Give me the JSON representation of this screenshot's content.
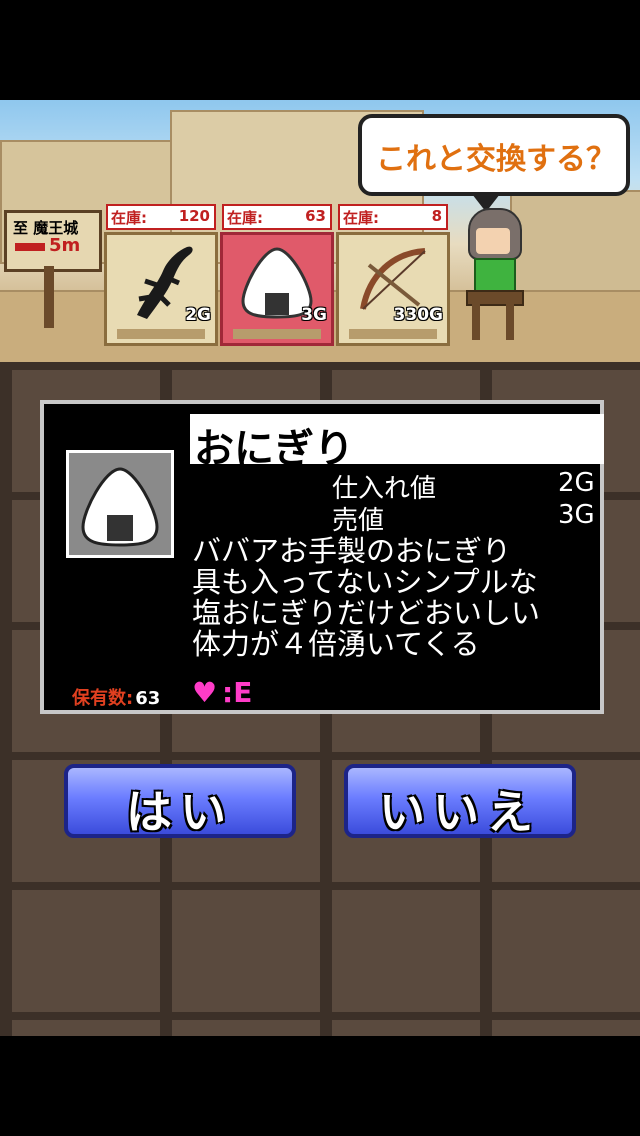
{
  "scene": {
    "signpost": {
      "line1": "至 魔王城",
      "line2": "5m"
    },
    "speech_bubble": "これと交換する？",
    "shop_slots": [
      {
        "stock_label": "在庫:",
        "stock_value": "120",
        "price": "2G",
        "item_icon": "lizard-icon",
        "selected": false
      },
      {
        "stock_label": "在庫:",
        "stock_value": "63",
        "price": "3G",
        "item_icon": "onigiri-icon",
        "selected": true
      },
      {
        "stock_label": "在庫:",
        "stock_value": "8",
        "price": "330G",
        "item_icon": "bow-icon",
        "selected": false
      }
    ]
  },
  "item_panel": {
    "name": "おにぎり",
    "purchase_price_label": "仕入れ値",
    "purchase_price_value": "2G",
    "sell_price_label": "売値",
    "sell_price_value": "3G",
    "description_lines": [
      "ババアお手製のおにぎり",
      "具も入ってないシンプルな",
      "塩おにぎりだけどおいしい",
      "体力が４倍湧いてくる"
    ],
    "owned_label": "保有数:",
    "owned_value": "63",
    "rank_symbol": "♥",
    "rank_separator": ":",
    "rank_value": "E"
  },
  "buttons": {
    "yes": "はい",
    "no": "いいえ"
  },
  "colors": {
    "accent_orange": "#e07010",
    "stock_red": "#c02020",
    "button_blue": "#6b7dff",
    "heart_pink": "#ff3cc8"
  }
}
